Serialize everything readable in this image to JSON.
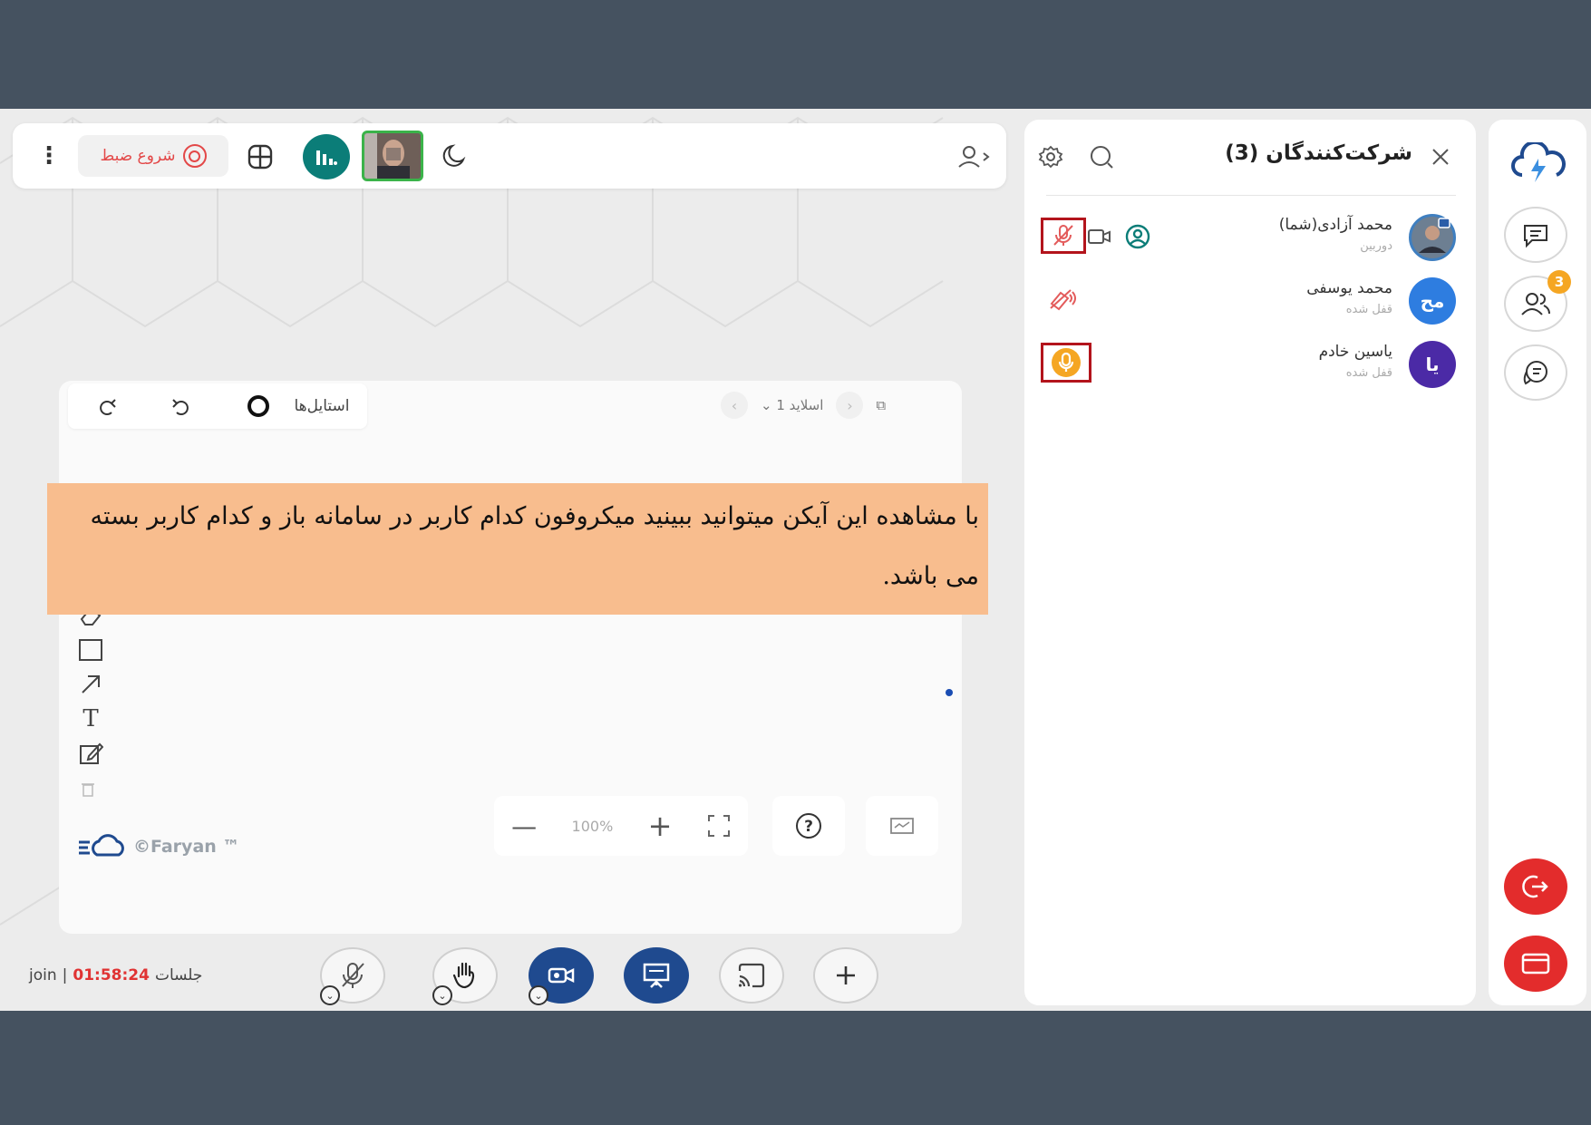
{
  "top_bar": {
    "record_label": "شروع ضبط",
    "menu_icon": "kebab-icon",
    "layout_icon": "layout-grid-icon",
    "stats_icon": "bar-chart-icon",
    "theme_icon": "moon-icon",
    "participants_toggle_icon": "user-arrow-icon"
  },
  "whiteboard": {
    "styles_label": "استایل‌ها",
    "slide_label": "اسلاید 1",
    "zoom_value": "100%",
    "watermark": "©Faryan ™"
  },
  "callout": {
    "text": "با مشاهده این آیکن میتوانید ببینید میکروفون کدام کاربر در سامانه باز و کدام کاربر بسته می باشد."
  },
  "bottom_bar": {
    "session_prefix": "جلسات",
    "session_time": "01:58:24",
    "session_separator": "|",
    "session_suffix": "join",
    "controls": [
      "mic-off-icon",
      "raise-hand-icon",
      "camera-icon",
      "presentation-icon",
      "screen-cast-icon",
      "plus-icon"
    ]
  },
  "participants": {
    "title": "شرکت‌کنندگان (3)",
    "list": [
      {
        "name": "محمد آزادی(شما)",
        "status": "دوربین",
        "mic": "muted"
      },
      {
        "name": "محمد یوسفی",
        "status": "قفل شده",
        "initials": "مح",
        "mic": "disabled"
      },
      {
        "name": "یاسین خادم",
        "status": "قفل شده",
        "initials": "یا",
        "mic": "active"
      }
    ]
  },
  "rail": {
    "participants_badge": "3"
  },
  "colors": {
    "frame": "#455260",
    "callout": "#f8bd8e",
    "accent_teal": "#0b7d78",
    "accent_blue": "#1f4a8f",
    "danger": "#e32c2c",
    "highlight_box": "#b3141c",
    "mic_active": "#f5a623"
  }
}
